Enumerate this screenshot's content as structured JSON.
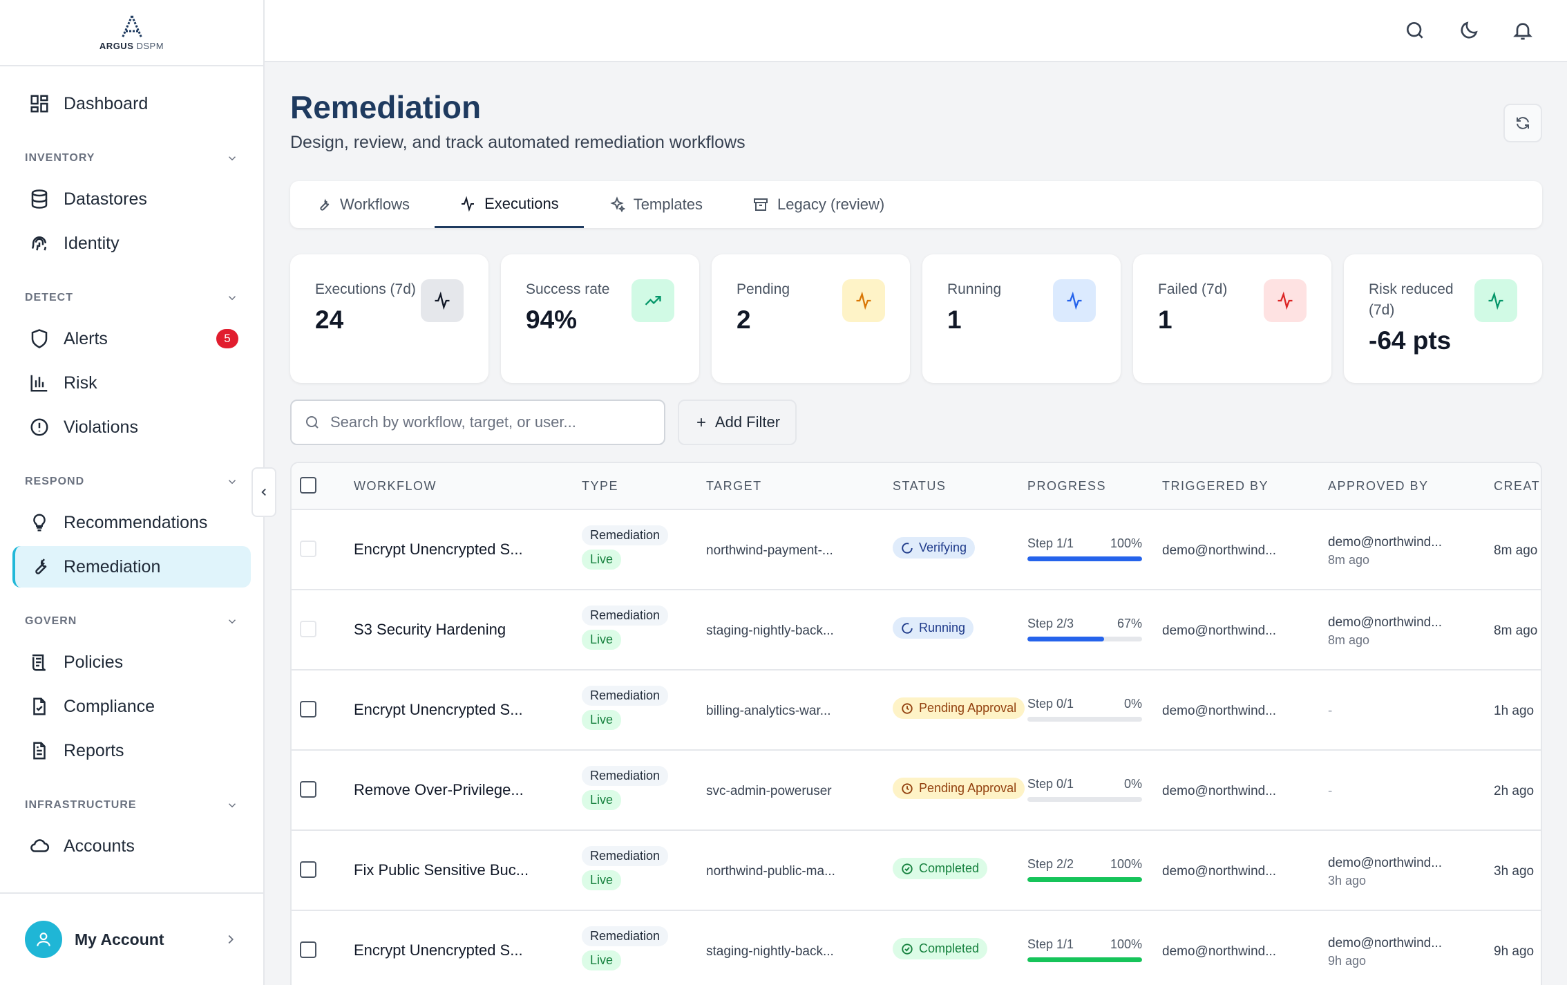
{
  "brand": {
    "name_bold": "ARGUS",
    "name_light": "DSPM"
  },
  "sidebar": {
    "dashboard": "Dashboard",
    "sections": {
      "inventory": "INVENTORY",
      "detect": "DETECT",
      "respond": "RESPOND",
      "govern": "GOVERN",
      "infrastructure": "INFRASTRUCTURE"
    },
    "items": {
      "datastores": "Datastores",
      "identity": "Identity",
      "alerts": "Alerts",
      "alerts_badge": "5",
      "risk": "Risk",
      "violations": "Violations",
      "recommendations": "Recommendations",
      "remediation": "Remediation",
      "policies": "Policies",
      "compliance": "Compliance",
      "reports": "Reports",
      "accounts": "Accounts"
    },
    "account": "My Account"
  },
  "page": {
    "title": "Remediation",
    "subtitle": "Design, review, and track automated remediation workflows"
  },
  "tabs": [
    {
      "label": "Workflows"
    },
    {
      "label": "Executions"
    },
    {
      "label": "Templates"
    },
    {
      "label": "Legacy (review)"
    }
  ],
  "stats": [
    {
      "label": "Executions (7d)",
      "value": "24"
    },
    {
      "label": "Success rate",
      "value": "94%"
    },
    {
      "label": "Pending",
      "value": "2"
    },
    {
      "label": "Running",
      "value": "1"
    },
    {
      "label": "Failed (7d)",
      "value": "1"
    },
    {
      "label": "Risk reduced (7d)",
      "value": "-64 pts"
    }
  ],
  "colors": {
    "accent": "#22b8d8",
    "progress_blue": "#2563eb",
    "progress_green": "#16c45a"
  },
  "search": {
    "placeholder": "Search by workflow, target, or user..."
  },
  "add_filter": "Add Filter",
  "table": {
    "headers": {
      "workflow": "WORKFLOW",
      "type": "TYPE",
      "target": "TARGET",
      "status": "STATUS",
      "progress": "PROGRESS",
      "triggered_by": "TRIGGERED BY",
      "approved_by": "APPROVED BY",
      "created": "CREATE"
    },
    "rows": [
      {
        "workflow": "Encrypt Unencrypted S...",
        "type": "Remediation",
        "mode": "Live",
        "target": "northwind-payment-...",
        "status": "Verifying",
        "step": "Step 1/1",
        "pct": "100%",
        "progress": 1.0,
        "triggered_by": "demo@northwind...",
        "approved_by": "demo@northwind...",
        "approved_ago": "8m ago",
        "created": "8m ago"
      },
      {
        "workflow": "S3 Security Hardening",
        "type": "Remediation",
        "mode": "Live",
        "target": "staging-nightly-back...",
        "status": "Running",
        "step": "Step 2/3",
        "pct": "67%",
        "progress": 0.67,
        "triggered_by": "demo@northwind...",
        "approved_by": "demo@northwind...",
        "approved_ago": "8m ago",
        "created": "8m ago"
      },
      {
        "workflow": "Encrypt Unencrypted S...",
        "type": "Remediation",
        "mode": "Live",
        "target": "billing-analytics-war...",
        "status": "Pending Approval",
        "step": "Step 0/1",
        "pct": "0%",
        "progress": 0.0,
        "triggered_by": "demo@northwind...",
        "approved_by": "-",
        "approved_ago": "",
        "created": "1h ago"
      },
      {
        "workflow": "Remove Over-Privilege...",
        "type": "Remediation",
        "mode": "Live",
        "target": "svc-admin-poweruser",
        "status": "Pending Approval",
        "step": "Step 0/1",
        "pct": "0%",
        "progress": 0.0,
        "triggered_by": "demo@northwind...",
        "approved_by": "-",
        "approved_ago": "",
        "created": "2h ago"
      },
      {
        "workflow": "Fix Public Sensitive Buc...",
        "type": "Remediation",
        "mode": "Live",
        "target": "northwind-public-ma...",
        "status": "Completed",
        "step": "Step 2/2",
        "pct": "100%",
        "progress": 1.0,
        "triggered_by": "demo@northwind...",
        "approved_by": "demo@northwind...",
        "approved_ago": "3h ago",
        "created": "3h ago"
      },
      {
        "workflow": "Encrypt Unencrypted S...",
        "type": "Remediation",
        "mode": "Live",
        "target": "staging-nightly-back...",
        "status": "Completed",
        "step": "Step 1/1",
        "pct": "100%",
        "progress": 1.0,
        "triggered_by": "demo@northwind...",
        "approved_by": "demo@northwind...",
        "approved_ago": "9h ago",
        "created": "9h ago"
      }
    ]
  }
}
